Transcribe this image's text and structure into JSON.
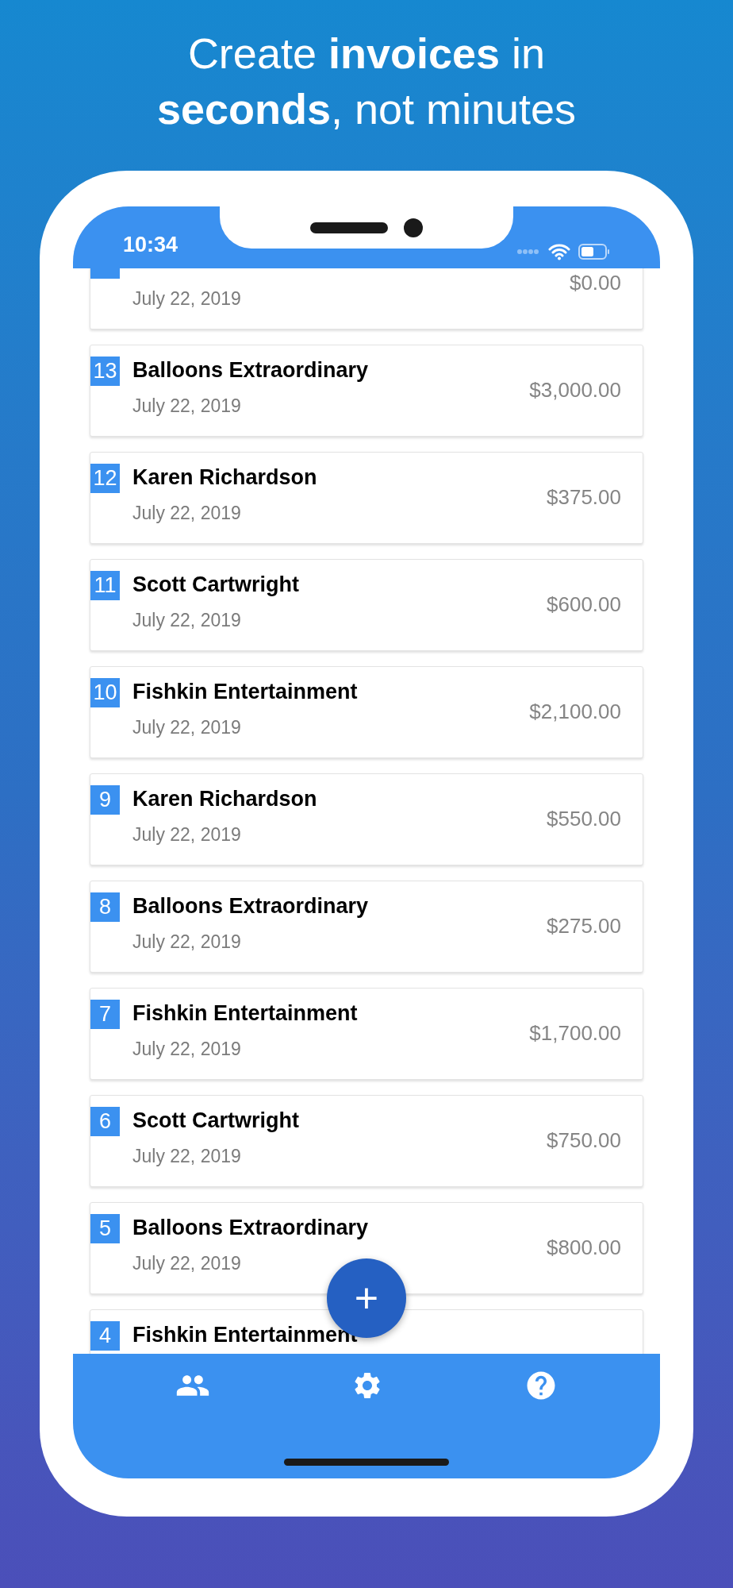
{
  "headline": [
    "Create **invoices** in",
    "**seconds**, not minutes"
  ],
  "status_bar": {
    "time": "10:34"
  },
  "invoices": [
    {
      "date": "July 22, 2019",
      "amount": "$0.00"
    },
    {
      "number": "13",
      "client": "Balloons Extraordinary",
      "date": "July 22, 2019",
      "amount": "$3,000.00"
    },
    {
      "number": "12",
      "client": "Karen Richardson",
      "date": "July 22, 2019",
      "amount": "$375.00"
    },
    {
      "number": "11",
      "client": "Scott Cartwright",
      "date": "July 22, 2019",
      "amount": "$600.00"
    },
    {
      "number": "10",
      "client": "Fishkin Entertainment",
      "date": "July 22, 2019",
      "amount": "$2,100.00"
    },
    {
      "number": "9",
      "client": "Karen Richardson",
      "date": "July 22, 2019",
      "amount": "$550.00"
    },
    {
      "number": "8",
      "client": "Balloons Extraordinary",
      "date": "July 22, 2019",
      "amount": "$275.00"
    },
    {
      "number": "7",
      "client": "Fishkin Entertainment",
      "date": "July 22, 2019",
      "amount": "$1,700.00"
    },
    {
      "number": "6",
      "client": "Scott Cartwright",
      "date": "July 22, 2019",
      "amount": "$750.00"
    },
    {
      "number": "5",
      "client": "Balloons Extraordinary",
      "date": "July 22, 2019",
      "amount": "$800.00"
    },
    {
      "number": "4",
      "client": "Fishkin Entertainment"
    }
  ],
  "fab": {
    "label": "+"
  },
  "tab_bar": [
    {
      "kind": "clients"
    },
    {
      "kind": "settings"
    },
    {
      "kind": "help"
    }
  ]
}
